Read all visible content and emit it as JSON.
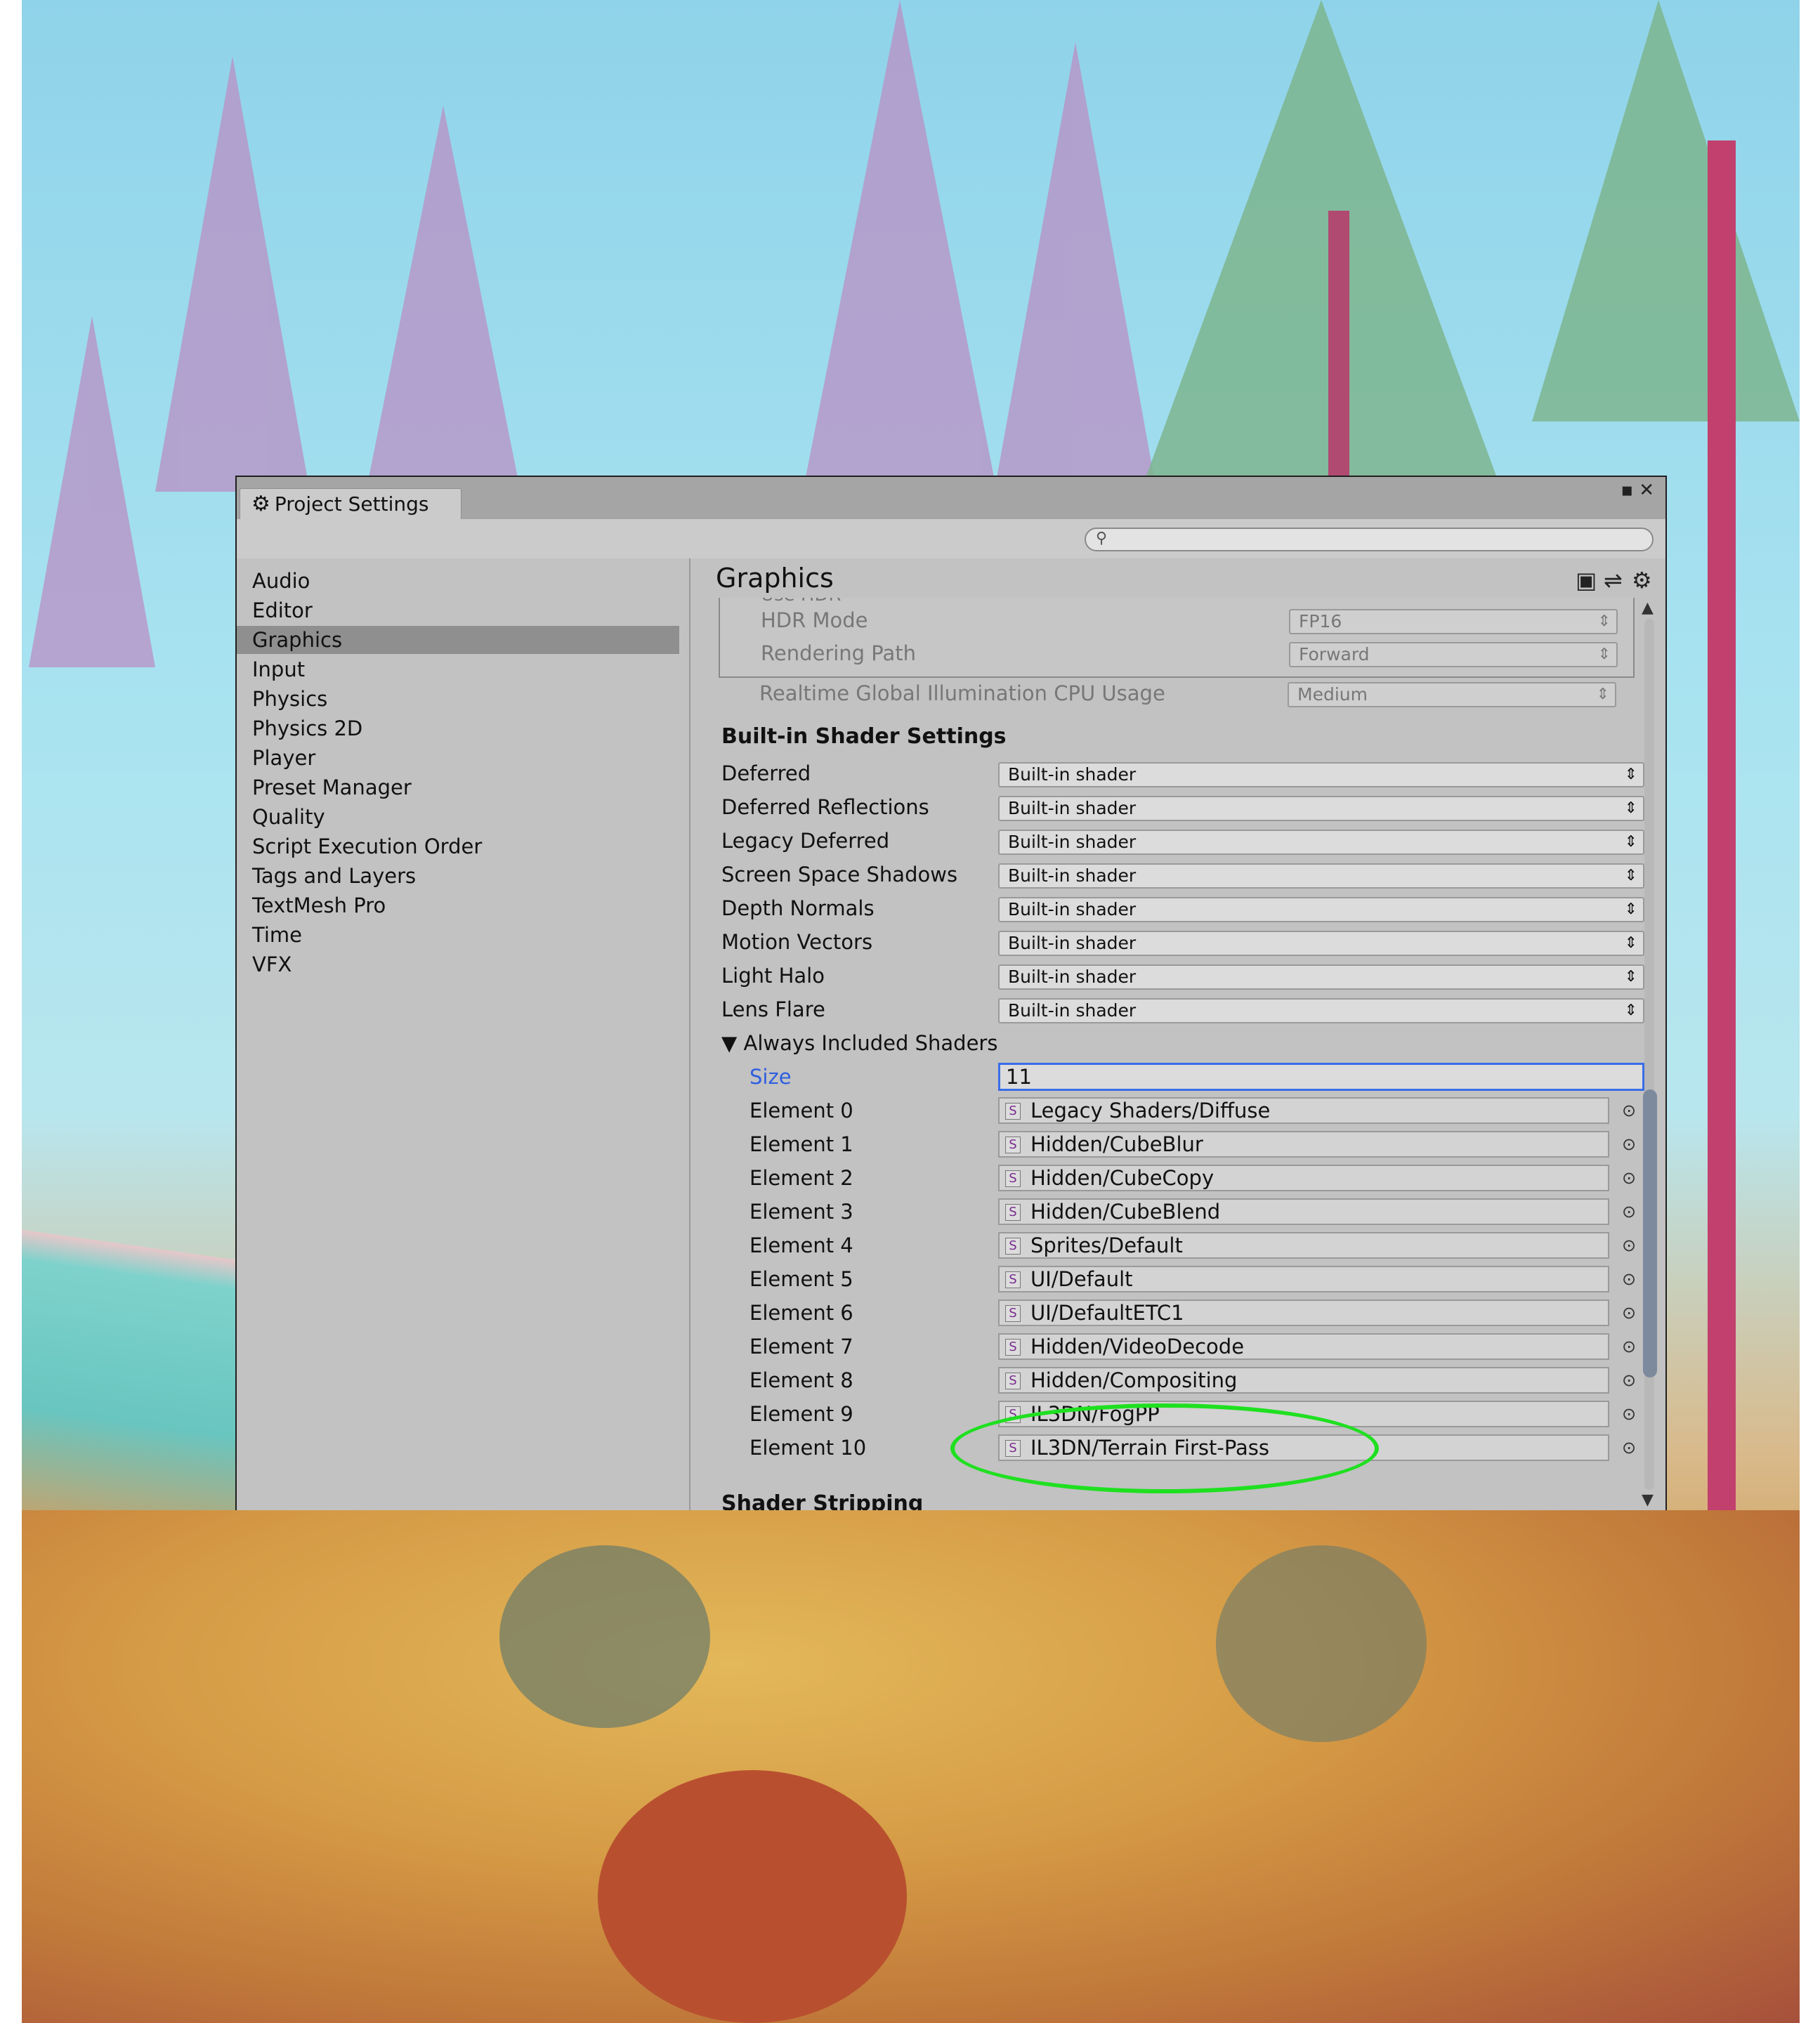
{
  "window": {
    "tab_title": "Project Settings",
    "controls": "▪ ✕"
  },
  "sidebar": {
    "items": [
      {
        "label": "Audio"
      },
      {
        "label": "Editor"
      },
      {
        "label": "Graphics",
        "selected": true
      },
      {
        "label": "Input"
      },
      {
        "label": "Physics"
      },
      {
        "label": "Physics 2D"
      },
      {
        "label": "Player"
      },
      {
        "label": "Preset Manager"
      },
      {
        "label": "Quality"
      },
      {
        "label": "Script Execution Order"
      },
      {
        "label": "Tags and Layers"
      },
      {
        "label": "TextMesh Pro"
      },
      {
        "label": "Time"
      },
      {
        "label": "VFX"
      }
    ]
  },
  "content": {
    "title": "Graphics",
    "tier": {
      "use_hdr_label": "Use HDR",
      "hdr_mode_label": "HDR Mode",
      "hdr_mode_value": "FP16",
      "rendering_path_label": "Rendering Path",
      "rendering_path_value": "Forward",
      "rgi_label": "Realtime Global Illumination CPU Usage",
      "rgi_value": "Medium"
    },
    "builtin_section": "Built-in Shader Settings",
    "builtin_rows": [
      {
        "label": "Deferred",
        "value": "Built-in shader"
      },
      {
        "label": "Deferred Reflections",
        "value": "Built-in shader"
      },
      {
        "label": "Legacy Deferred",
        "value": "Built-in shader"
      },
      {
        "label": "Screen Space Shadows",
        "value": "Built-in shader"
      },
      {
        "label": "Depth Normals",
        "value": "Built-in shader"
      },
      {
        "label": "Motion Vectors",
        "value": "Built-in shader"
      },
      {
        "label": "Light Halo",
        "value": "Built-in shader"
      },
      {
        "label": "Lens Flare",
        "value": "Built-in shader"
      }
    ],
    "always_included": {
      "label": "Always Included Shaders",
      "size_label": "Size",
      "size_value": "11",
      "elements": [
        {
          "label": "Element 0",
          "value": "Legacy Shaders/Diffuse"
        },
        {
          "label": "Element 1",
          "value": "Hidden/CubeBlur"
        },
        {
          "label": "Element 2",
          "value": "Hidden/CubeCopy"
        },
        {
          "label": "Element 3",
          "value": "Hidden/CubeBlend"
        },
        {
          "label": "Element 4",
          "value": "Sprites/Default"
        },
        {
          "label": "Element 5",
          "value": "UI/Default"
        },
        {
          "label": "Element 6",
          "value": "UI/DefaultETC1"
        },
        {
          "label": "Element 7",
          "value": "Hidden/VideoDecode"
        },
        {
          "label": "Element 8",
          "value": "Hidden/Compositing"
        },
        {
          "label": "Element 9",
          "value": "IL3DN/FogPP"
        },
        {
          "label": "Element 10",
          "value": "IL3DN/Terrain First-Pass"
        }
      ]
    },
    "next_section": "Shader Stripping"
  },
  "colors": {
    "selection": "#8f8f8f",
    "focus_border": "#3a6ee8",
    "highlight_ellipse": "#1fe020"
  }
}
